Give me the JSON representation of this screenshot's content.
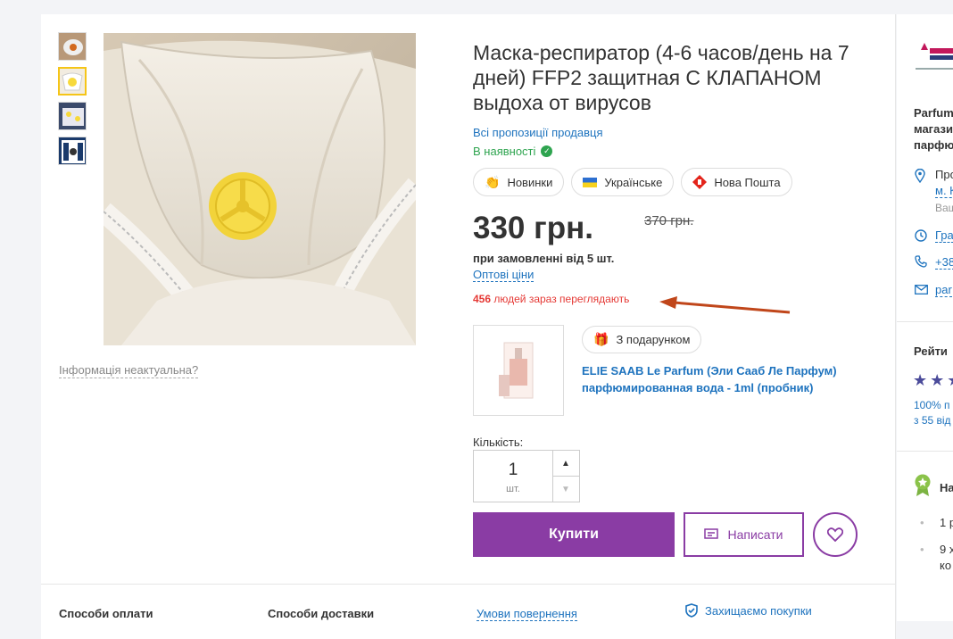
{
  "product": {
    "title": "Маска-респиратор (4-6 часов/день на 7 дней) FFP2 защитная С КЛАПАНОМ выдоха от вирусов",
    "seller_link": "Всі пропозиції продавця",
    "availability": "В наявності",
    "badges": [
      "Новинки",
      "Українське",
      "Нова Пошта"
    ],
    "price": "330 грн.",
    "old_price": "370 грн.",
    "min_order": "при замовленні від 5 шт.",
    "wholesale_link": "Оптові ціни",
    "viewers_count": "456",
    "viewers_text": "людей зараз переглядають",
    "info_outdated": "Інформація неактуальна?"
  },
  "gift": {
    "badge": "З подарунком",
    "name": "ELIE SAAB Le Parfum (Эли Сааб Ле Парфум) парфюмированная вода - 1ml (пробник)"
  },
  "quantity": {
    "label": "Кількість:",
    "value": "1",
    "unit": "шт."
  },
  "actions": {
    "buy": "Купити",
    "write": "Написати"
  },
  "footer": {
    "payment": "Способи оплати",
    "delivery": "Способи доставки",
    "terms": "Умови повернення",
    "protect": "Захищаємо покупки"
  },
  "sidebar": {
    "shop_lines": [
      "Parfum",
      "магази",
      "парфю"
    ],
    "address_lines": [
      "Про",
      "м. К",
      "Ваш"
    ],
    "schedule": "Гра",
    "phone": "+38",
    "email": "par",
    "rating_label": "Рейти",
    "rating_lines": [
      "100% п",
      "з 55 від"
    ],
    "award_label": "На",
    "award_items": [
      "1 р",
      "9 х",
      "ко"
    ]
  },
  "colors": {
    "accent": "#8a3ca4",
    "link": "#1e73be",
    "success": "#2ea44f",
    "alert": "#e53935",
    "arrow": "#c0461a"
  }
}
